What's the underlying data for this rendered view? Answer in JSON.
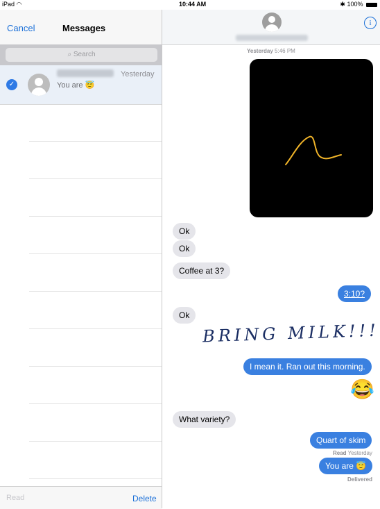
{
  "status": {
    "device": "iPad",
    "time": "10:44 AM",
    "battery": "100%"
  },
  "left": {
    "cancel": "Cancel",
    "title": "Messages",
    "search_placeholder": "Search",
    "conversation": {
      "time": "Yesterday",
      "preview": "You are 😇"
    },
    "read": "Read",
    "delete": "Delete"
  },
  "thread": {
    "timestamp_label": "Yesterday",
    "timestamp_time": "5:46 PM",
    "messages": [
      {
        "dir": "in",
        "text": "Ok"
      },
      {
        "dir": "in",
        "text": "Ok"
      },
      {
        "dir": "in",
        "text": "Coffee at 3?"
      },
      {
        "dir": "out",
        "text": "3:10?"
      },
      {
        "dir": "in",
        "text": "Ok"
      },
      {
        "dir": "out",
        "text": "BRING MILK!!!"
      },
      {
        "dir": "out",
        "text": "I mean it. Ran out this morning."
      },
      {
        "dir": "out",
        "text": "😂"
      },
      {
        "dir": "in",
        "text": "What variety?"
      },
      {
        "dir": "out",
        "text": "Quart of skim"
      },
      {
        "dir": "out",
        "text": "You are 😇"
      }
    ],
    "read_receipt_label": "Read",
    "read_receipt_time": "Yesterday",
    "delivered": "Delivered"
  },
  "colors": {
    "accent": "#1a6fd8",
    "outgoing": "#3a80e0",
    "incoming": "#e5e5ea",
    "ink_scribble": "#f0b429",
    "ink_handwriting": "#1b2e63"
  },
  "icons": {
    "wifi": "wifi-icon",
    "bluetooth": "bluetooth-icon",
    "battery": "battery-icon",
    "info": "info-icon",
    "check": "checkmark-icon",
    "avatar": "person-icon"
  }
}
